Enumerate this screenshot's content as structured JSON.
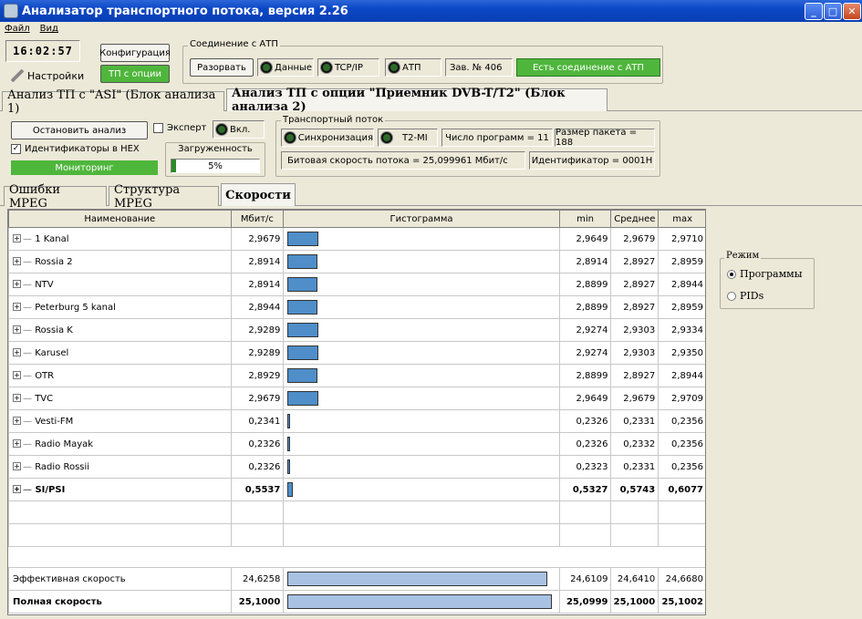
{
  "window": {
    "title": "Анализатор транспортного потока, версия 2.26"
  },
  "menu": [
    "Файл",
    "Вид"
  ],
  "clock": "16:02:57",
  "settings_label": "Настройки",
  "config_button": "Конфигурация",
  "tp_options_button": "ТП с опции",
  "connection": {
    "legend": "Соединение с АТП",
    "disconnect_button": "Разорвать",
    "data_label": "Данные",
    "tcpip_label": "TCP/IP",
    "atp_label": "АТП",
    "serial": "Зав. № 406",
    "status": "Есть соединение с АТП"
  },
  "main_tabs": [
    "Анализ ТП с \"ASI\" (Блок анализа 1)",
    "Анализ ТП с опции \"Приемник DVB-T/T2\" (Блок анализа 2)"
  ],
  "controls": {
    "stop_button": "Остановить анализ",
    "expert_label": "Эксперт",
    "on_label": "Вкл.",
    "hex_label": "Идентификаторы в  HEX",
    "monitoring": "Мониторинг",
    "load_label": "Загруженность",
    "load_value": "5%",
    "load_fraction": 0.05
  },
  "transport": {
    "legend": "Транспортный поток",
    "sync_label": "Синхронизация",
    "t2mi_label": "T2-MI",
    "programs": "Число программ = 11",
    "packet_size": "Размер пакета = 188",
    "bitrate": "Битовая скорость потока = 25,099961 Мбит/с",
    "identifier": "Идентификатор = 0001H"
  },
  "sub_tabs": [
    "Ошибки MPEG",
    "Структура MPEG",
    "Скорости"
  ],
  "table": {
    "headers": [
      "Наименование",
      "Мбит/с",
      "Гистограмма",
      "min",
      "Среднее",
      "max"
    ],
    "rows": [
      {
        "name": "1 Kanal",
        "rate": "2,9679",
        "min": "2,9649",
        "avg": "2,9679",
        "max": "2,9710",
        "bar": 2.9679
      },
      {
        "name": "Rossia 2",
        "rate": "2,8914",
        "min": "2,8914",
        "avg": "2,8927",
        "max": "2,8959",
        "bar": 2.8914
      },
      {
        "name": "NTV",
        "rate": "2,8914",
        "min": "2,8899",
        "avg": "2,8927",
        "max": "2,8944",
        "bar": 2.8914
      },
      {
        "name": "Peterburg 5 kanal",
        "rate": "2,8944",
        "min": "2,8899",
        "avg": "2,8927",
        "max": "2,8959",
        "bar": 2.8944
      },
      {
        "name": "Rossia K",
        "rate": "2,9289",
        "min": "2,9274",
        "avg": "2,9303",
        "max": "2,9334",
        "bar": 2.9289
      },
      {
        "name": "Karusel",
        "rate": "2,9289",
        "min": "2,9274",
        "avg": "2,9303",
        "max": "2,9350",
        "bar": 2.9289
      },
      {
        "name": "OTR",
        "rate": "2,8929",
        "min": "2,8899",
        "avg": "2,8927",
        "max": "2,8944",
        "bar": 2.8929
      },
      {
        "name": "TVC",
        "rate": "2,9679",
        "min": "2,9649",
        "avg": "2,9679",
        "max": "2,9709",
        "bar": 2.9679
      },
      {
        "name": "Vesti-FM",
        "rate": "0,2341",
        "min": "0,2326",
        "avg": "0,2331",
        "max": "0,2356",
        "bar": 0.2341
      },
      {
        "name": "Radio Mayak",
        "rate": "0,2326",
        "min": "0,2326",
        "avg": "0,2332",
        "max": "0,2356",
        "bar": 0.2326
      },
      {
        "name": "Radio Rossii",
        "rate": "0,2326",
        "min": "0,2323",
        "avg": "0,2331",
        "max": "0,2356",
        "bar": 0.2326
      },
      {
        "name": "SI/PSI",
        "rate": "0,5537",
        "min": "0,5327",
        "avg": "0,5743",
        "max": "0,6077",
        "bar": 0.5537,
        "bold": true
      }
    ],
    "effective": {
      "name": "Эффективная скорость",
      "rate": "24,6258",
      "min": "24,6109",
      "avg": "24,6410",
      "max": "24,6680",
      "bar": 24.6258
    },
    "total": {
      "name": "Полная скорость",
      "rate": "25,1000",
      "min": "25,0999",
      "avg": "25,1000",
      "max": "25,1002",
      "bar": 25.1
    }
  },
  "mode": {
    "legend": "Режим",
    "options": [
      "Программы",
      "PIDs"
    ],
    "selected": 0
  },
  "colors": {
    "accent_green": "#4fb63c",
    "bar": "#4f8ec9",
    "bar_light": "#a9c2e3"
  }
}
